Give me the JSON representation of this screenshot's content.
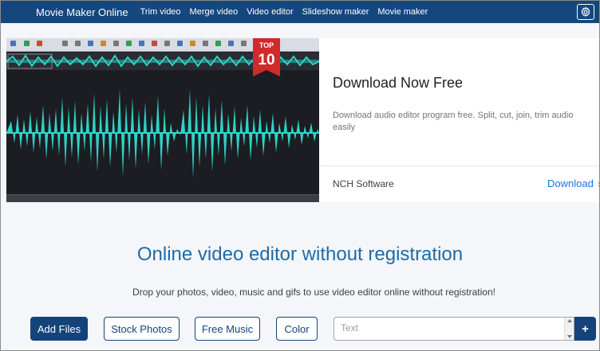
{
  "navbar": {
    "brand": "Movie Maker Online",
    "links": [
      {
        "label": "Trim video"
      },
      {
        "label": "Merge video"
      },
      {
        "label": "Video editor"
      },
      {
        "label": "Slideshow maker"
      },
      {
        "label": "Movie maker"
      }
    ],
    "settings_icon": "gear-icon"
  },
  "ad": {
    "badge_top": "TOP",
    "badge_num": "10",
    "title": "Download Now Free",
    "description": "Download audio editor program free. Split, cut, join, trim audio easily",
    "sponsor": "NCH Software",
    "cta": "Download",
    "arrow": "›"
  },
  "main": {
    "headline": "Online video editor without registration",
    "subline": "Drop your photos, video, music and gifs to use video editor online without registration!"
  },
  "controls": {
    "add_files": "Add Files",
    "stock_photos": "Stock Photos",
    "free_music": "Free Music",
    "color": "Color",
    "text_placeholder": "Text",
    "add_text": "+"
  },
  "colors": {
    "navbar": "#14477e",
    "primary": "#13437a",
    "headline": "#1e6ba8",
    "waveform": "#2ed3c6",
    "link": "#1a73e8"
  }
}
